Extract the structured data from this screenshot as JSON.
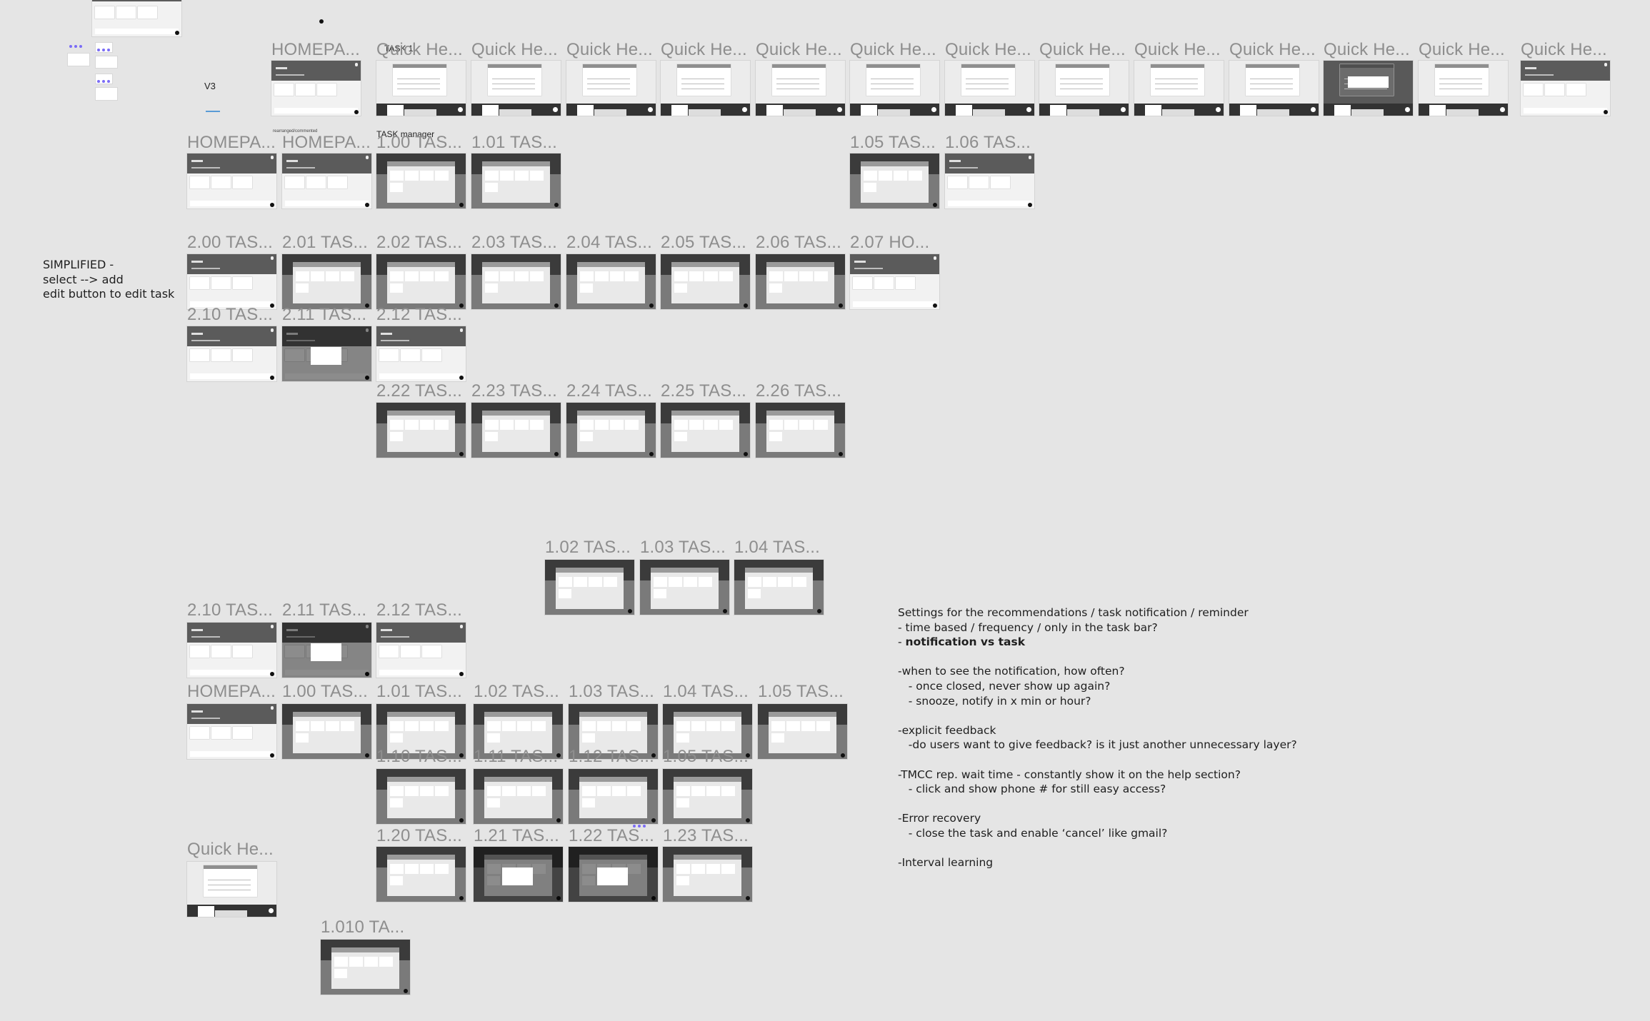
{
  "canvas": {
    "background": "#e5e5e5",
    "annotations": {
      "v3": "V3",
      "task1": "TASK 1",
      "task_manager": "TASK manager",
      "rearranged_note": "rearranged/commented",
      "simplified_note": [
        "SIMPLIFIED -",
        "select --> add",
        "edit button to edit task"
      ]
    }
  },
  "frames": {
    "row_top": [
      {
        "label": "HOMEPA...",
        "type": "homepage"
      },
      {
        "label": "Quick He...",
        "type": "quickhelp"
      },
      {
        "label": "Quick He...",
        "type": "quickhelp"
      },
      {
        "label": "Quick He...",
        "type": "quickhelp"
      },
      {
        "label": "Quick He...",
        "type": "quickhelp"
      },
      {
        "label": "Quick He...",
        "type": "quickhelp"
      },
      {
        "label": "Quick He...",
        "type": "quickhelp"
      },
      {
        "label": "Quick He...",
        "type": "quickhelp"
      },
      {
        "label": "Quick He...",
        "type": "quickhelp"
      },
      {
        "label": "Quick He...",
        "type": "quickhelp"
      },
      {
        "label": "Quick He...",
        "type": "quickhelp"
      },
      {
        "label": "Quick He...",
        "type": "quickhelp-dim"
      },
      {
        "label": "Quick He...",
        "type": "quickhelp"
      },
      {
        "label": "Quick He...",
        "type": "homepage"
      }
    ],
    "row_1xx": [
      {
        "label": "HOMEPA...",
        "type": "homepage"
      },
      {
        "label": "HOMEPA...",
        "type": "homepage"
      },
      {
        "label": "1.00 TAS...",
        "type": "taskmanager"
      },
      {
        "label": "1.01 TAS...",
        "type": "taskmanager"
      },
      {
        "label": "1.05 TAS...",
        "type": "taskmanager"
      },
      {
        "label": "1.06 TAS...",
        "type": "homepage"
      }
    ],
    "row_2xx": [
      {
        "label": "2.00 TAS...",
        "type": "homepage"
      },
      {
        "label": "2.01 TAS...",
        "type": "taskmanager"
      },
      {
        "label": "2.02 TAS...",
        "type": "taskmanager"
      },
      {
        "label": "2.03 TAS...",
        "type": "taskmanager"
      },
      {
        "label": "2.04 TAS...",
        "type": "taskmanager"
      },
      {
        "label": "2.05 TAS...",
        "type": "taskmanager"
      },
      {
        "label": "2.06 TAS...",
        "type": "taskmanager"
      },
      {
        "label": "2.07 HO...",
        "type": "homepage"
      }
    ],
    "row_21x": [
      {
        "label": "2.10 TAS...",
        "type": "homepage"
      },
      {
        "label": "2.11 TAS...",
        "type": "homepage-confirm"
      },
      {
        "label": "2.12 TAS...",
        "type": "homepage"
      }
    ],
    "row_22x": [
      {
        "label": "2.22 TAS...",
        "type": "taskmanager"
      },
      {
        "label": "2.23 TAS...",
        "type": "taskmanager"
      },
      {
        "label": "2.24 TAS...",
        "type": "taskmanager"
      },
      {
        "label": "2.25 TAS...",
        "type": "taskmanager"
      },
      {
        "label": "2.26 TAS...",
        "type": "taskmanager"
      }
    ],
    "row_102": [
      {
        "label": "1.02 TAS...",
        "type": "taskmanager"
      },
      {
        "label": "1.03 TAS...",
        "type": "taskmanager"
      },
      {
        "label": "1.04 TAS...",
        "type": "taskmanager"
      }
    ],
    "row_21x_b": [
      {
        "label": "2.10 TAS...",
        "type": "homepage"
      },
      {
        "label": "2.11 TAS...",
        "type": "homepage-confirm"
      },
      {
        "label": "2.12 TAS...",
        "type": "homepage"
      }
    ],
    "row_home_b": [
      {
        "label": "HOMEPA...",
        "type": "homepage"
      },
      {
        "label": "1.00 TAS...",
        "type": "taskmanager"
      },
      {
        "label": "1.01 TAS...",
        "type": "taskmanager"
      },
      {
        "label": "1.02 TAS...",
        "type": "taskmanager"
      },
      {
        "label": "1.03 TAS...",
        "type": "taskmanager"
      },
      {
        "label": "1.04 TAS...",
        "type": "taskmanager"
      },
      {
        "label": "1.05 TAS...",
        "type": "taskmanager"
      }
    ],
    "row_110": [
      {
        "label": "1.10 TAS...",
        "type": "taskmanager"
      },
      {
        "label": "1.11 TAS...",
        "type": "taskmanager"
      },
      {
        "label": "1.12 TAS...",
        "type": "taskmanager"
      },
      {
        "label": "1.05 TAS...",
        "type": "taskmanager"
      }
    ],
    "row_120": [
      {
        "label": "1.20 TAS...",
        "type": "taskmanager"
      },
      {
        "label": "1.21 TAS...",
        "type": "taskmanager-confirm"
      },
      {
        "label": "1.22 TAS...",
        "type": "taskmanager-confirm"
      },
      {
        "label": "1.23 TAS...",
        "type": "taskmanager"
      }
    ],
    "quick_bottom": {
      "label": "Quick He...",
      "type": "quickhelp"
    },
    "row_1010": {
      "label": "1.010 TA...",
      "type": "taskmanager"
    }
  },
  "notes": {
    "lines": [
      {
        "text": "Settings for the recommendations / task notification / reminder",
        "bold": false
      },
      {
        "text": "- time based / frequency / only in the task bar?",
        "bold": false
      },
      {
        "prefix": "- ",
        "text": "notification vs task",
        "bold": true
      },
      {
        "text": "",
        "bold": false
      },
      {
        "text": "-when to see the notification, how often?",
        "bold": false
      },
      {
        "text": "   - once closed, never show up again?",
        "bold": false
      },
      {
        "text": "   - snooze, notify in x min or hour?",
        "bold": false
      },
      {
        "text": "",
        "bold": false
      },
      {
        "text": "-explicit feedback",
        "bold": false
      },
      {
        "text": "   -do users want to give feedback? is it just another unnecessary layer?",
        "bold": false
      },
      {
        "text": "",
        "bold": false
      },
      {
        "text": "-TMCC rep. wait time - constantly show it on the help section?",
        "bold": false
      },
      {
        "text": "   - click and show phone # for still easy access?",
        "bold": false
      },
      {
        "text": "",
        "bold": false
      },
      {
        "text": "-Error recovery",
        "bold": false
      },
      {
        "text": "   - close the task and enable ‘cancel’ like gmail?",
        "bold": false
      },
      {
        "text": "",
        "bold": false
      },
      {
        "text": "-Interval learning",
        "bold": false
      }
    ]
  },
  "colors": {
    "canvas": "#e5e5e5",
    "label_gray": "#8e8e8e",
    "header_dark": "#5b5b5b",
    "comment_dot": "#7b6cf6"
  }
}
